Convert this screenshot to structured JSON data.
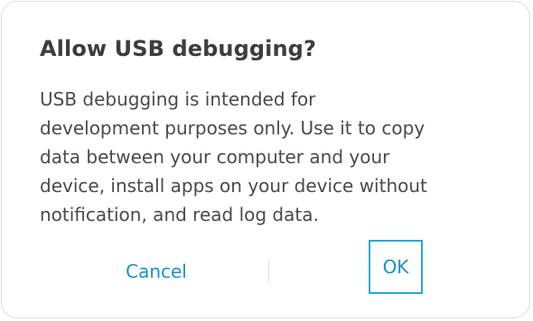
{
  "dialog": {
    "title": "Allow USB debugging?",
    "message_lines": [
      "USB debugging is intended for",
      "development purposes only. Use it to copy",
      "data between your computer and your",
      "device, install apps on your device without",
      "notification, and read log data."
    ],
    "buttons": {
      "cancel_label": "Cancel",
      "ok_label": "OK"
    },
    "colors": {
      "accent": "#1a90c8",
      "focus_border": "#29a8d8",
      "title_text": "#3d3d3d",
      "body_text": "#4a4a4a"
    }
  }
}
